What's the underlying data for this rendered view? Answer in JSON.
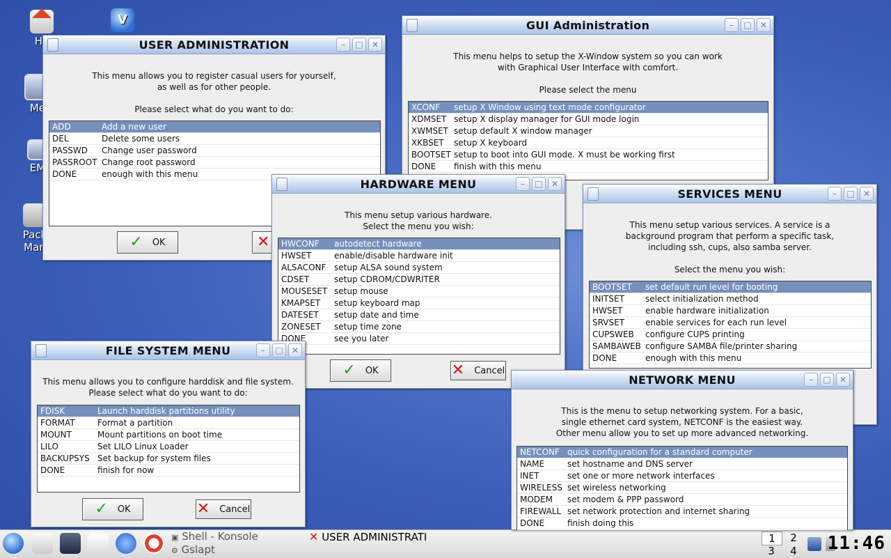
{
  "desktop_icons": [
    {
      "label": "Ho",
      "icon": "home-icon"
    },
    {
      "label": "",
      "icon": "v-logo-icon"
    },
    {
      "label": "Me",
      "icon": "monitor-icon"
    },
    {
      "label": "EM",
      "icon": "calendar-icon"
    },
    {
      "label": "Pack\nMan",
      "icon": "package-icon"
    }
  ],
  "windows": {
    "user_admin": {
      "title": "USER ADMINISTRATION",
      "text": "This menu allows you to register casual users for yourself,\nas well as for other people.\n\nPlease select what do you want to do:",
      "items": [
        [
          "ADD",
          "Add a new user"
        ],
        [
          "DEL",
          "Delete some users"
        ],
        [
          "PASSWD",
          "Change user password"
        ],
        [
          "PASSROOT",
          "Change root password"
        ],
        [
          "DONE",
          "enough with this menu"
        ]
      ],
      "ok": "OK"
    },
    "gui_admin": {
      "title": "GUI Administration",
      "text": "This menu helps to setup the X-Window system so you can work\nwith Graphical User Interface with comfort.\n\nPlease select the menu",
      "items": [
        [
          "XCONF",
          "setup X Window using text mode configurator"
        ],
        [
          "XDMSET",
          "setup X display manager for GUI mode login"
        ],
        [
          "XWMSET",
          "setup default X window manager"
        ],
        [
          "XKBSET",
          "setup X keyboard"
        ],
        [
          "BOOTSET",
          "setup to boot into GUI mode. X must be working first"
        ],
        [
          "DONE",
          "finish with this menu"
        ]
      ]
    },
    "hardware": {
      "title": "HARDWARE MENU",
      "text": "This menu setup various hardware.\nSelect the menu you wish:",
      "items": [
        [
          "HWCONF",
          "autodetect hardware"
        ],
        [
          "HWSET",
          "enable/disable hardware init"
        ],
        [
          "ALSACONF",
          "setup ALSA sound system"
        ],
        [
          "CDSET",
          "setup CDROM/CDWRITER"
        ],
        [
          "MOUSESET",
          "setup mouse"
        ],
        [
          "KMAPSET",
          "setup keyboard map"
        ],
        [
          "DATESET",
          "setup date and time"
        ],
        [
          "ZONESET",
          "setup time zone"
        ],
        [
          "DONE",
          "see you later"
        ]
      ],
      "ok": "OK",
      "cancel": "Cancel"
    },
    "services": {
      "title": "SERVICES MENU",
      "text": "This menu setup various services. A service is a\nbackground program that perform a specific task,\nincluding ssh, cups, also samba server.\n\nSelect the menu you wish:",
      "items": [
        [
          "BOOTSET",
          "set default run level for booting"
        ],
        [
          "INITSET",
          "select initialization method"
        ],
        [
          "HWSET",
          "enable hardware initialization"
        ],
        [
          "SRVSET",
          "enable services for each run level"
        ],
        [
          "CUPSWEB",
          "configure CUPS printing"
        ],
        [
          "SAMBAWEB",
          "configure SAMBA file/printer sharing"
        ],
        [
          "DONE",
          "enough with this menu"
        ]
      ]
    },
    "filesystem": {
      "title": "FILE SYSTEM MENU",
      "text": "This menu allows you to configure harddisk and file system.\nPlease select what do you want to do:",
      "items": [
        [
          "FDISK",
          "Launch harddisk partitions utility"
        ],
        [
          "FORMAT",
          "Format a partition"
        ],
        [
          "MOUNT",
          "Mount partitions on boot time"
        ],
        [
          "LILO",
          "Set LILO Linux Loader"
        ],
        [
          "BACKUPSYS",
          "Set backup for system files"
        ],
        [
          "DONE",
          "finish for now"
        ]
      ],
      "ok": "OK",
      "cancel": "Cancel"
    },
    "network": {
      "title": "NETWORK MENU",
      "text": "This is the menu to setup networking system. For a basic,\nsingle ethernet card system, NETCONF is the easiest way.\nOther menu allow you to set up more advanced networking.",
      "items": [
        [
          "NETCONF",
          "quick configuration for a standard computer"
        ],
        [
          "NAME",
          "set hostname and DNS server"
        ],
        [
          "INET",
          "set one or more network interfaces"
        ],
        [
          "WIRELESS",
          "set wireless networking"
        ],
        [
          "MODEM",
          "set modem & PPP password"
        ],
        [
          "FIREWALL",
          "set network protection and internet sharing"
        ],
        [
          "DONE",
          "finish doing this"
        ]
      ]
    }
  },
  "taskbar": {
    "tasks": [
      "Shell - Konsole",
      "Gslapt",
      "USER ADMINISTRATI"
    ],
    "pager": [
      "1",
      "2",
      "3",
      "4"
    ],
    "clock": "11:46"
  }
}
